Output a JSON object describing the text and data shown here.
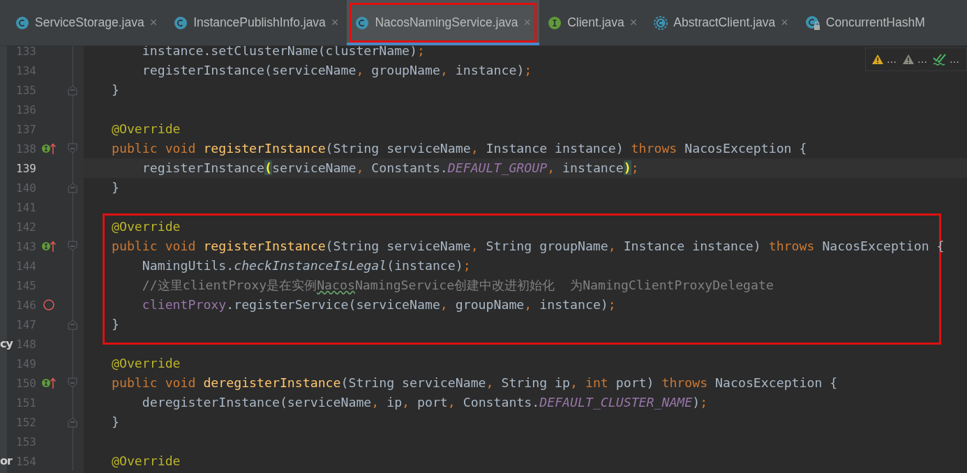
{
  "tabs": [
    {
      "label": "ServiceStorage.java",
      "kind": "class",
      "close": "×",
      "selected": false,
      "outlined": false
    },
    {
      "label": "InstancePublishInfo.java",
      "kind": "class",
      "close": "×",
      "selected": false,
      "outlined": false
    },
    {
      "label": "NacosNamingService.java",
      "kind": "class",
      "close": "×",
      "selected": true,
      "outlined": true
    },
    {
      "label": "Client.java",
      "kind": "interface",
      "close": "×",
      "selected": false,
      "outlined": false
    },
    {
      "label": "AbstractClient.java",
      "kind": "abstract",
      "close": "×",
      "selected": false,
      "outlined": false
    },
    {
      "label": "ConcurrentHashM",
      "kind": "class_locked",
      "selected": false,
      "outlined": false
    }
  ],
  "inspections": [
    {
      "kind": "warning",
      "label": "…"
    },
    {
      "kind": "weak_warning",
      "label": "…"
    },
    {
      "kind": "typo",
      "label": "…"
    }
  ],
  "lines": [
    {
      "number": "133",
      "kind": "plain",
      "current": false,
      "boxed": false,
      "tokens": [
        {
          "kind": "plain",
          "text": "    instance.setClusterName(clusterName)"
        },
        {
          "kind": "punct",
          "text": ";"
        }
      ]
    },
    {
      "number": "134",
      "kind": "plain",
      "current": false,
      "boxed": false,
      "tokens": [
        {
          "kind": "plain",
          "text": "    registerInstance(serviceName"
        },
        {
          "kind": "punct",
          "text": ", "
        },
        {
          "kind": "plain",
          "text": "groupName"
        },
        {
          "kind": "punct",
          "text": ", "
        },
        {
          "kind": "plain",
          "text": "instance)"
        },
        {
          "kind": "punct",
          "text": ";"
        }
      ]
    },
    {
      "number": "135",
      "kind": "plain",
      "current": false,
      "boxed": false,
      "fold_end": true,
      "tokens": [
        {
          "kind": "plain",
          "text": "}"
        }
      ]
    },
    {
      "number": "136",
      "kind": "plain",
      "current": false,
      "boxed": false
    },
    {
      "number": "137",
      "kind": "plain",
      "current": false,
      "boxed": false,
      "tokens": [
        {
          "kind": "annotation",
          "text": "@Override"
        }
      ]
    },
    {
      "number": "138",
      "kind": "implements",
      "current": false,
      "boxed": false,
      "fold_start": true,
      "tokens": [
        {
          "kind": "keyword",
          "text": "public void "
        },
        {
          "kind": "method",
          "text": "registerInstance"
        },
        {
          "kind": "plain",
          "text": "(String serviceName"
        },
        {
          "kind": "punct",
          "text": ", "
        },
        {
          "kind": "plain",
          "text": "Instance instance) "
        },
        {
          "kind": "keyword",
          "text": "throws "
        },
        {
          "kind": "plain",
          "text": "NacosException {"
        }
      ]
    },
    {
      "number": "139",
      "kind": "plain",
      "current": true,
      "boxed": false,
      "tokens": [
        {
          "kind": "plain",
          "text": "    registerInstance"
        },
        {
          "kind": "matched",
          "text": "("
        },
        {
          "kind": "plain",
          "text": "serviceName"
        },
        {
          "kind": "punct",
          "text": ", "
        },
        {
          "kind": "plain",
          "text": "Constants."
        },
        {
          "kind": "static",
          "text": "DEFAULT_GROUP"
        },
        {
          "kind": "punct",
          "text": ", "
        },
        {
          "kind": "plain",
          "text": "instance"
        },
        {
          "kind": "matched",
          "text": ")"
        },
        {
          "kind": "punct",
          "text": ";"
        }
      ]
    },
    {
      "number": "140",
      "kind": "plain",
      "current": false,
      "boxed": false,
      "fold_end": true,
      "tokens": [
        {
          "kind": "plain",
          "text": "}"
        }
      ]
    },
    {
      "number": "141",
      "kind": "plain",
      "current": false,
      "boxed": false
    },
    {
      "number": "142",
      "kind": "plain",
      "current": false,
      "boxed": true,
      "tokens": [
        {
          "kind": "annotation",
          "text": "@Override"
        }
      ]
    },
    {
      "number": "143",
      "kind": "implements",
      "current": false,
      "boxed": true,
      "fold_start": true,
      "tokens": [
        {
          "kind": "keyword",
          "text": "public void "
        },
        {
          "kind": "method",
          "text": "registerInstance"
        },
        {
          "kind": "plain",
          "text": "(String serviceName"
        },
        {
          "kind": "punct",
          "text": ", "
        },
        {
          "kind": "plain",
          "text": "String groupName"
        },
        {
          "kind": "punct",
          "text": ", "
        },
        {
          "kind": "plain",
          "text": "Instance instance) "
        },
        {
          "kind": "keyword",
          "text": "throws "
        },
        {
          "kind": "plain",
          "text": "NacosException {"
        }
      ]
    },
    {
      "number": "144",
      "kind": "plain",
      "current": false,
      "boxed": true,
      "tokens": [
        {
          "kind": "plain",
          "text": "    NamingUtils."
        },
        {
          "kind": "static_call",
          "text": "checkInstanceIsLegal"
        },
        {
          "kind": "plain",
          "text": "(instance)"
        },
        {
          "kind": "punct",
          "text": ";"
        }
      ]
    },
    {
      "number": "145",
      "kind": "plain",
      "current": false,
      "boxed": true,
      "tokens": [
        {
          "kind": "comment",
          "text": "    //这里clientProxy是在实例"
        },
        {
          "kind": "comment_typo",
          "text": "Nacos"
        },
        {
          "kind": "comment",
          "text": "NamingService创建中改进初始化  为NamingClientProxyDelegate"
        }
      ]
    },
    {
      "number": "146",
      "kind": "breakpoint",
      "current": false,
      "boxed": true,
      "tokens": [
        {
          "kind": "field",
          "text": "    clientProxy"
        },
        {
          "kind": "plain",
          "text": ".registerService(serviceName"
        },
        {
          "kind": "punct",
          "text": ", "
        },
        {
          "kind": "plain",
          "text": "groupName"
        },
        {
          "kind": "punct",
          "text": ", "
        },
        {
          "kind": "plain",
          "text": "instance)"
        },
        {
          "kind": "punct",
          "text": ";"
        }
      ]
    },
    {
      "number": "147",
      "kind": "plain",
      "current": false,
      "boxed": true,
      "fold_end": true,
      "tokens": [
        {
          "kind": "plain",
          "text": "}"
        }
      ]
    },
    {
      "number": "148",
      "kind": "plain",
      "current": false,
      "boxed": false,
      "side_fragment": "cy"
    },
    {
      "number": "149",
      "kind": "plain",
      "current": false,
      "boxed": false,
      "tokens": [
        {
          "kind": "annotation",
          "text": "@Override"
        }
      ]
    },
    {
      "number": "150",
      "kind": "implements",
      "current": false,
      "boxed": false,
      "fold_start": true,
      "tokens": [
        {
          "kind": "keyword",
          "text": "public void "
        },
        {
          "kind": "method",
          "text": "deregisterInstance"
        },
        {
          "kind": "plain",
          "text": "(String serviceName"
        },
        {
          "kind": "punct",
          "text": ", "
        },
        {
          "kind": "plain",
          "text": "String ip"
        },
        {
          "kind": "punct",
          "text": ", "
        },
        {
          "kind": "keyword",
          "text": "int "
        },
        {
          "kind": "plain",
          "text": "port) "
        },
        {
          "kind": "keyword",
          "text": "throws "
        },
        {
          "kind": "plain",
          "text": "NacosException {"
        }
      ]
    },
    {
      "number": "151",
      "kind": "plain",
      "current": false,
      "boxed": false,
      "tokens": [
        {
          "kind": "plain",
          "text": "    deregisterInstance(serviceName"
        },
        {
          "kind": "punct",
          "text": ", "
        },
        {
          "kind": "plain",
          "text": "ip"
        },
        {
          "kind": "punct",
          "text": ", "
        },
        {
          "kind": "plain",
          "text": "port"
        },
        {
          "kind": "punct",
          "text": ", "
        },
        {
          "kind": "plain",
          "text": "Constants."
        },
        {
          "kind": "static",
          "text": "DEFAULT_CLUSTER_NAME"
        },
        {
          "kind": "plain",
          "text": ")"
        },
        {
          "kind": "punct",
          "text": ";"
        }
      ]
    },
    {
      "number": "152",
      "kind": "plain",
      "current": false,
      "boxed": false,
      "fold_end": true,
      "tokens": [
        {
          "kind": "plain",
          "text": "}"
        }
      ]
    },
    {
      "number": "153",
      "kind": "plain",
      "current": false,
      "boxed": false
    },
    {
      "number": "154",
      "kind": "plain",
      "current": false,
      "boxed": false,
      "side_fragment": "or",
      "tokens": [
        {
          "kind": "annotation",
          "text": "@Override"
        }
      ]
    }
  ]
}
